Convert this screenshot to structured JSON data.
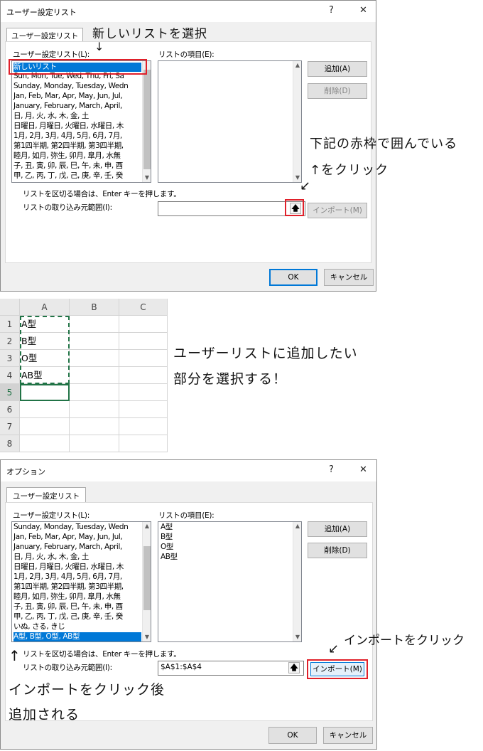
{
  "dialog1": {
    "title": "ユーザー設定リスト",
    "help": "?",
    "close": "✕",
    "tab": "ユーザー設定リスト",
    "lists_label": "ユーザー設定リスト(L):",
    "items_label": "リストの項目(E):",
    "lists": [
      "新しいリスト",
      "Sun, Mon, Tue, Wed, Thu, Fri, Sa",
      "Sunday, Monday, Tuesday, Wedn",
      "Jan, Feb, Mar, Apr, May, Jun, Jul,",
      "January, February, March, April,",
      "日, 月, 火, 水, 木, 金, 土",
      "日曜日, 月曜日, 火曜日, 水曜日, 木",
      "1月, 2月, 3月, 4月, 5月, 6月, 7月,",
      "第1四半期, 第2四半期, 第3四半期,",
      "睦月, 如月, 弥生, 卯月, 皐月, 水無",
      "子, 丑, 寅, 卯, 辰, 巳, 午, 未, 申, 酉",
      "甲, 乙, 丙, 丁, 戊, 己, 庚, 辛, 壬, 癸"
    ],
    "add_button": "追加(A)",
    "delete_button": "削除(D)",
    "hint": "リストを区切る場合は、Enter キーを押します。",
    "import_label": "リストの取り込み元範囲(I):",
    "import_value": "",
    "import_button": "インポート(M)",
    "ok_button": "OK",
    "cancel_button": "キャンセル"
  },
  "annotations1": {
    "select_new_list": "新しいリストを選択",
    "down_arrow": "↓",
    "click_line1": "下記の赤枠で囲んでいる",
    "click_line2": "↑をクリック",
    "diag_arrow": "↙"
  },
  "sheet": {
    "columns": [
      "A",
      "B",
      "C"
    ],
    "rows": [
      "1",
      "2",
      "3",
      "4",
      "5",
      "6",
      "7",
      "8"
    ],
    "values": [
      "A型",
      "B型",
      "O型",
      "AB型"
    ]
  },
  "annotations2": {
    "line1": "ユーザーリストに追加したい",
    "line2": "部分を選択する！"
  },
  "dialog2": {
    "title": "オプション",
    "help": "?",
    "close": "✕",
    "tab": "ユーザー設定リスト",
    "lists_label": "ユーザー設定リスト(L):",
    "items_label": "リストの項目(E):",
    "lists": [
      "Sunday, Monday, Tuesday, Wedn",
      "Jan, Feb, Mar, Apr, May, Jun, Jul,",
      "January, February, March, April,",
      "日, 月, 火, 水, 木, 金, 土",
      "日曜日, 月曜日, 火曜日, 水曜日, 木",
      "1月, 2月, 3月, 4月, 5月, 6月, 7月,",
      "第1四半期, 第2四半期, 第3四半期,",
      "睦月, 如月, 弥生, 卯月, 皐月, 水無",
      "子, 丑, 寅, 卯, 辰, 巳, 午, 未, 申, 酉",
      "甲, 乙, 丙, 丁, 戊, 己, 庚, 辛, 壬, 癸",
      "いぬ, さる, きじ",
      "A型, B型, O型, AB型"
    ],
    "items": [
      "A型",
      "B型",
      "O型",
      "AB型"
    ],
    "add_button": "追加(A)",
    "delete_button": "削除(D)",
    "hint": "リストを区切る場合は、Enter キーを押します。",
    "import_label": "リストの取り込み元範囲(I):",
    "import_value": "$A$1:$A$4",
    "import_button": "インポート(M)",
    "ok_button": "OK",
    "cancel_button": "キャンセル"
  },
  "annotations3": {
    "import_click": "インポートをクリック",
    "import_arrow": "↙",
    "up_arrow": "↑",
    "added_line1": "インポートをクリック後",
    "added_line2": "追加される"
  }
}
